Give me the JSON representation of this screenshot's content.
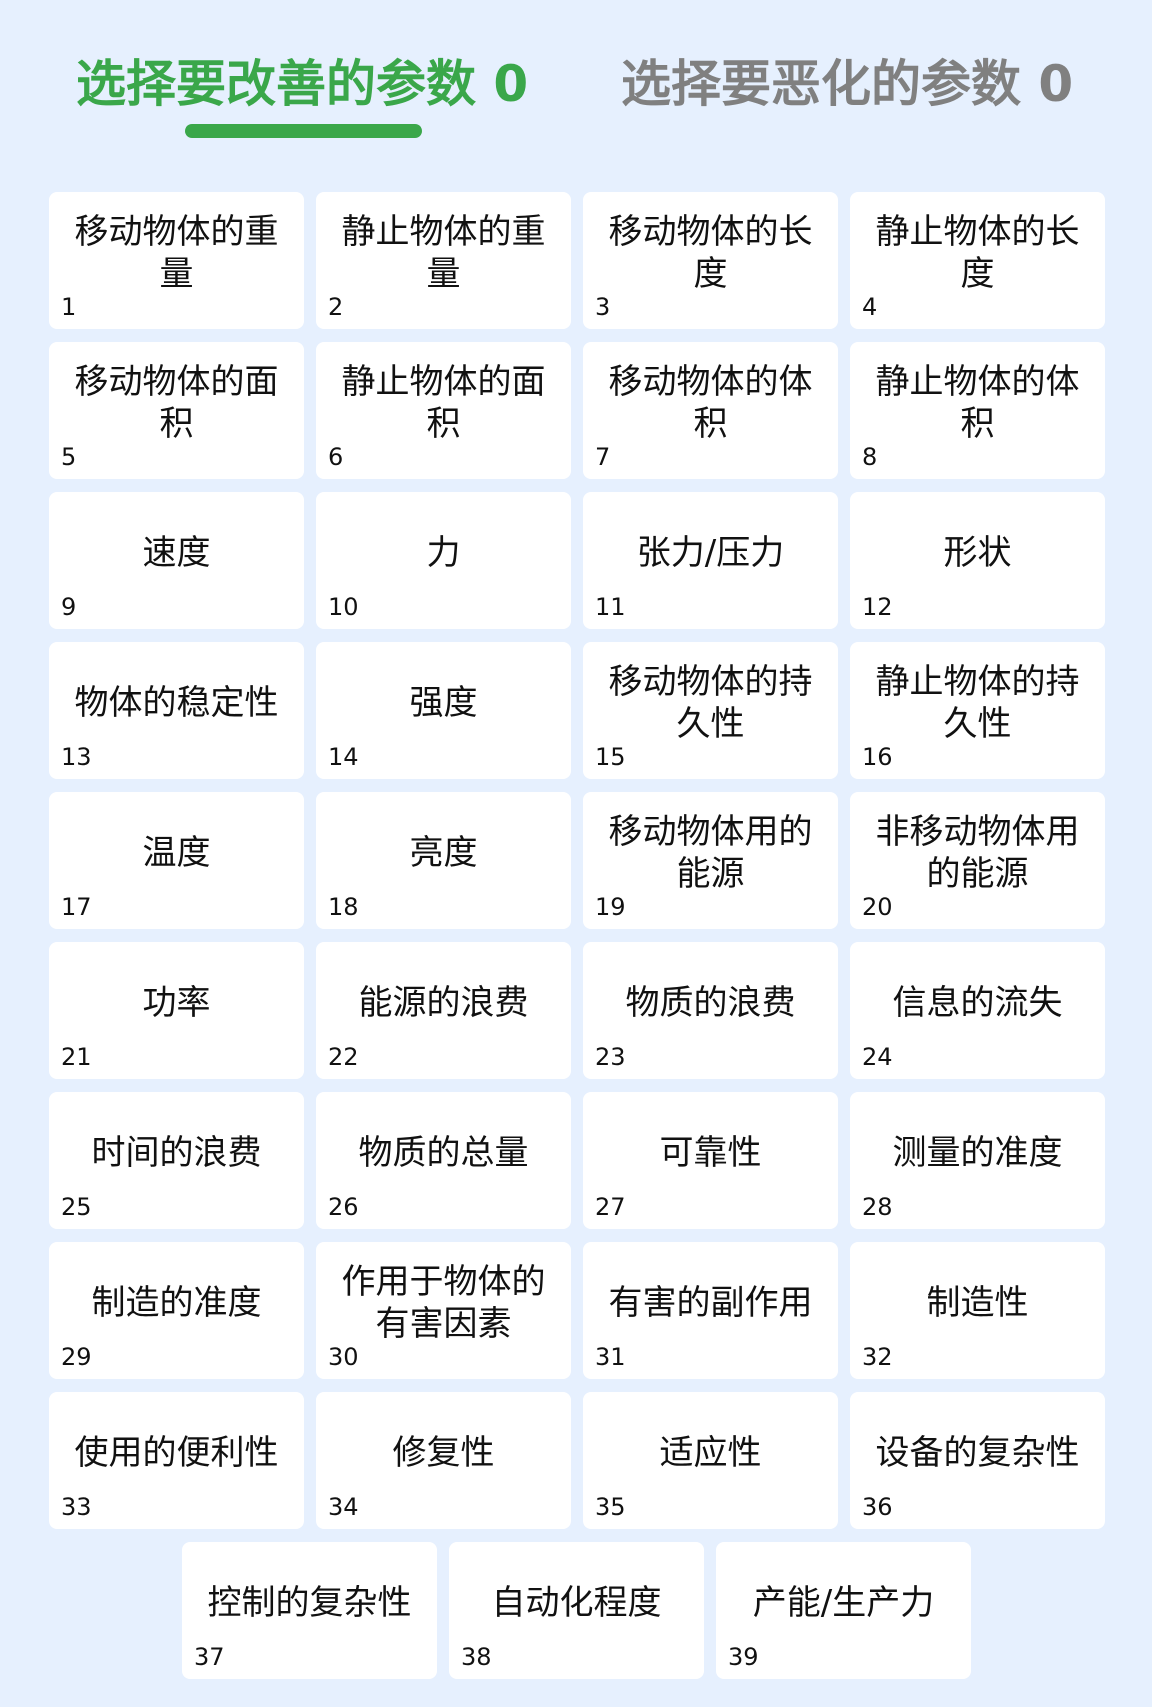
{
  "tabs": [
    {
      "label": "选择要改善的参数 0",
      "active": true
    },
    {
      "label": "选择要恶化的参数 0",
      "active": false
    }
  ],
  "colors": {
    "accent": "#3aa74a",
    "inactive": "#808080",
    "background": "#e6f0fe"
  },
  "params": [
    {
      "n": "1",
      "label": "移动物体的重量"
    },
    {
      "n": "2",
      "label": "静止物体的重量"
    },
    {
      "n": "3",
      "label": "移动物体的长度"
    },
    {
      "n": "4",
      "label": "静止物体的长度"
    },
    {
      "n": "5",
      "label": "移动物体的面积"
    },
    {
      "n": "6",
      "label": "静止物体的面积"
    },
    {
      "n": "7",
      "label": "移动物体的体积"
    },
    {
      "n": "8",
      "label": "静止物体的体积"
    },
    {
      "n": "9",
      "label": "速度"
    },
    {
      "n": "10",
      "label": "力"
    },
    {
      "n": "11",
      "label": "张力/压力"
    },
    {
      "n": "12",
      "label": "形状"
    },
    {
      "n": "13",
      "label": "物体的稳定性"
    },
    {
      "n": "14",
      "label": "强度"
    },
    {
      "n": "15",
      "label": "移动物体的持久性"
    },
    {
      "n": "16",
      "label": "静止物体的持久性"
    },
    {
      "n": "17",
      "label": "温度"
    },
    {
      "n": "18",
      "label": "亮度"
    },
    {
      "n": "19",
      "label": "移动物体用的能源"
    },
    {
      "n": "20",
      "label": "非移动物体用的能源"
    },
    {
      "n": "21",
      "label": "功率"
    },
    {
      "n": "22",
      "label": "能源的浪费"
    },
    {
      "n": "23",
      "label": "物质的浪费"
    },
    {
      "n": "24",
      "label": "信息的流失"
    },
    {
      "n": "25",
      "label": "时间的浪费"
    },
    {
      "n": "26",
      "label": "物质的总量"
    },
    {
      "n": "27",
      "label": "可靠性"
    },
    {
      "n": "28",
      "label": "测量的准度"
    },
    {
      "n": "29",
      "label": "制造的准度"
    },
    {
      "n": "30",
      "label": "作用于物体的有害因素"
    },
    {
      "n": "31",
      "label": "有害的副作用"
    },
    {
      "n": "32",
      "label": "制造性"
    },
    {
      "n": "33",
      "label": "使用的便利性"
    },
    {
      "n": "34",
      "label": "修复性"
    },
    {
      "n": "35",
      "label": "适应性"
    },
    {
      "n": "36",
      "label": "设备的复杂性"
    },
    {
      "n": "37",
      "label": "控制的复杂性"
    },
    {
      "n": "38",
      "label": "自动化程度"
    },
    {
      "n": "39",
      "label": "产能/生产力"
    }
  ]
}
